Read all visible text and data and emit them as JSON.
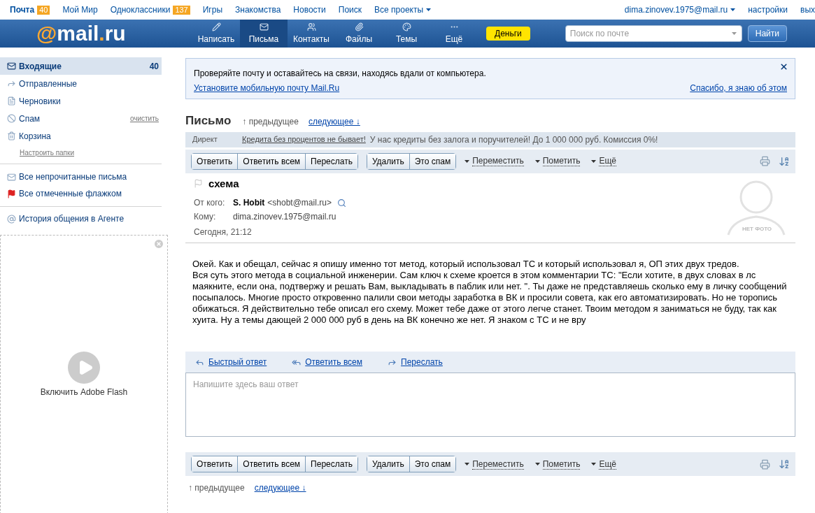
{
  "top_bar": {
    "left": [
      {
        "label": "Почта",
        "badge": "40",
        "selected": true
      },
      {
        "label": "Мой Мир",
        "selected": false
      },
      {
        "label": "Одноклассники",
        "badge": "137",
        "selected": false
      },
      {
        "label": "Игры",
        "selected": false
      },
      {
        "label": "Знакомства",
        "selected": false
      },
      {
        "label": "Новости",
        "selected": false
      },
      {
        "label": "Поиск",
        "selected": false
      },
      {
        "label": "Все проекты",
        "dropdown": true,
        "selected": false
      }
    ],
    "right": [
      {
        "label": "dima.zinovev.1975@mail.ru",
        "dropdown": true
      },
      {
        "label": "настройки",
        "dropdown": false
      },
      {
        "label": "вых",
        "dropdown": false
      }
    ]
  },
  "header": {
    "logo": {
      "at": "@",
      "main": "mail",
      "dot": ".",
      "tld": "ru"
    },
    "nav": [
      {
        "label": "Написать",
        "selected": false
      },
      {
        "label": "Письма",
        "selected": true
      },
      {
        "label": "Контакты",
        "selected": false
      },
      {
        "label": "Файлы",
        "selected": false
      },
      {
        "label": "Темы",
        "selected": false
      },
      {
        "label": "Ещё",
        "selected": false
      }
    ],
    "money_button": "Деньги",
    "search": {
      "placeholder": "Поиск по почте"
    },
    "search_button": "Найти"
  },
  "sidebar": {
    "folders": [
      {
        "label": "Входящие",
        "count": "40",
        "selected": true
      },
      {
        "label": "Отправленные",
        "selected": false
      },
      {
        "label": "Черновики",
        "selected": false
      },
      {
        "label": "Спам",
        "action": "очистить",
        "selected": false
      },
      {
        "label": "Корзина",
        "selected": false
      }
    ],
    "settings_link": "Настроить папки",
    "filters": [
      {
        "label": "Все непрочитанные письма"
      },
      {
        "label": "Все отмеченные флажком"
      }
    ],
    "agent_link": "История общения в Агенте",
    "flash": {
      "label": "Включить Adobe Flash"
    }
  },
  "notice": {
    "text": "Проверяйте почту и оставайтесь на связи, находясь вдали от компьютера.",
    "link": "Установите мобильную почту Mail.Ru",
    "dismiss": "Спасибо, я знаю об этом"
  },
  "letter": {
    "title": "Письмо",
    "prev": "↑ предыдущее",
    "next": "следующее ↓",
    "ad": {
      "label": "Директ",
      "link": "Кредита без процентов не бывает!",
      "text": "У нас кредиты без залога и поручителей! До 1 000 000 руб. Комиссия 0%!"
    },
    "toolbar_top": {
      "groups": [
        [
          "Ответить",
          "Ответить всем",
          "Переслать"
        ],
        [
          "Удалить",
          "Это спам"
        ]
      ],
      "menus": [
        "Переместить",
        "Пометить",
        "Ещё"
      ]
    },
    "subject": "схема",
    "flagged": false,
    "from_label": "От кого:",
    "from_name": "S. Hobit",
    "from_email": "<shobt@mail.ru>",
    "to_label": "Кому:",
    "to": "dima.zinovev.1975@mail.ru",
    "date": "Сегодня, 21:12",
    "no_photo": "НЕТ ФОТО",
    "body": [
      "Окей. Как и обещал, сейчас я опишу именно тот метод, который использовал ТС и который использовал я, ОП этих двух тредов.",
      "Вся суть этого метода в социальной инженерии. Сам ключ к схеме кроется в этом комментарии ТС: \"Если хотите, в двух словах в лс маякните, если она, подтвержу и решать Вам, выкладывать в паблик или нет. \". Ты даже не представляешь сколько ему в личку сообщений посыпалось. Многие просто откровенно палили свои методы заработка в ВК и просили совета, как его автоматизировать. Но не торопись обижаться. Я действительно тебе описал его схему. Может тебе даже от этого легче станет. Твоим методом я заниматься не буду, так как хуита. Ну а темы дающей 2 000 000 руб в день на ВК конечно же нет. Я знаком с ТС и не вру"
    ],
    "quick_reply": {
      "tabs": [
        {
          "label": "Быстрый ответ"
        },
        {
          "label": "Ответить всем"
        },
        {
          "label": "Переслать"
        }
      ],
      "placeholder": "Напишите здесь ваш ответ"
    },
    "toolbar_bottom": {
      "groups": [
        [
          "Ответить",
          "Ответить всем",
          "Переслать"
        ],
        [
          "Удалить",
          "Это спам"
        ]
      ],
      "menus": [
        "Переместить",
        "Пометить",
        "Ещё"
      ]
    },
    "prev_bottom": "↑ предыдущее",
    "next_bottom": "следующее ↓"
  }
}
